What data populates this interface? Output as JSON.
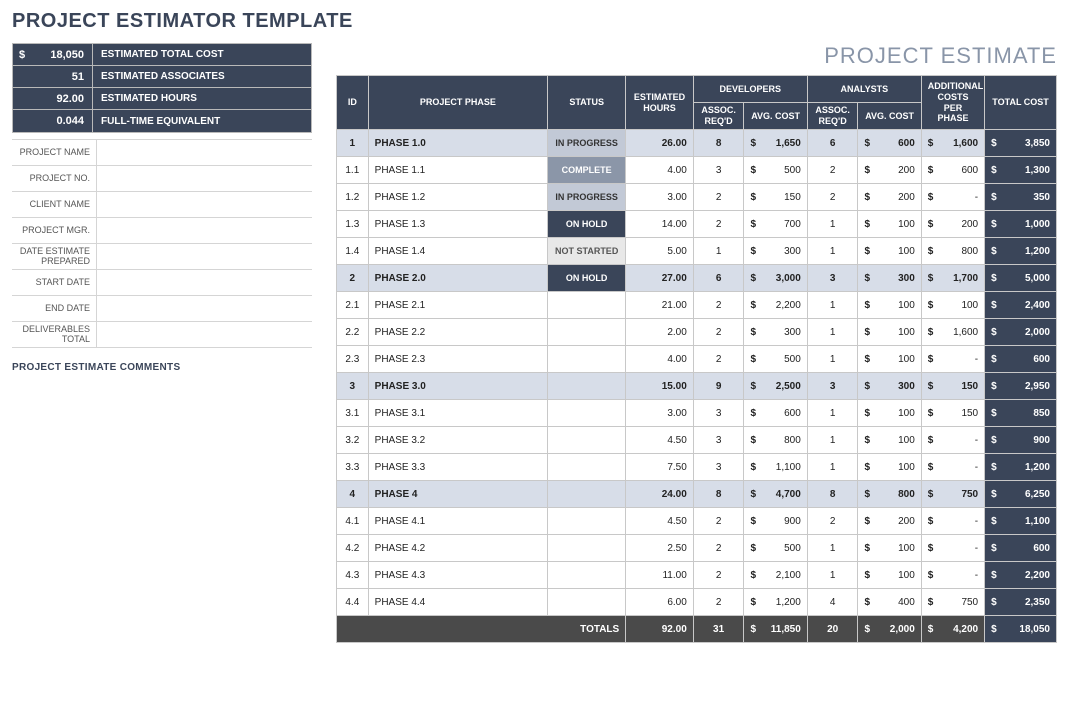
{
  "title": "PROJECT ESTIMATOR TEMPLATE",
  "est_title": "PROJECT ESTIMATE",
  "summary": [
    {
      "value": "18,050",
      "label": "ESTIMATED TOTAL COST",
      "money": true
    },
    {
      "value": "51",
      "label": "ESTIMATED ASSOCIATES"
    },
    {
      "value": "92.00",
      "label": "ESTIMATED HOURS"
    },
    {
      "value": "0.044",
      "label": "FULL-TIME EQUIVALENT"
    }
  ],
  "meta": [
    "PROJECT NAME",
    "PROJECT NO.",
    "CLIENT NAME",
    "PROJECT MGR.",
    "DATE ESTIMATE PREPARED",
    "START DATE",
    "END DATE",
    "DELIVERABLES TOTAL"
  ],
  "comments_label": "PROJECT ESTIMATE COMMENTS",
  "hdr": {
    "id": "ID",
    "phase": "PROJECT PHASE",
    "status": "STATUS",
    "hours": "ESTIMATED HOURS",
    "dev": "DEVELOPERS",
    "ana": "ANALYSTS",
    "assoc": "ASSOC. REQ'D",
    "avg": "AVG. COST",
    "add": "ADDITIONAL COSTS PER PHASE",
    "total": "TOTAL COST"
  },
  "rows": [
    {
      "id": "1",
      "phase": "PHASE 1.0",
      "status": "IN PROGRESS",
      "st": "progress",
      "hours": "26.00",
      "da": "8",
      "dc": "1,650",
      "aa": "6",
      "ac": "600",
      "add": "1,600",
      "total": "3,850",
      "parent": true
    },
    {
      "id": "1.1",
      "phase": "PHASE 1.1",
      "status": "COMPLETE",
      "st": "complete",
      "hours": "4.00",
      "da": "3",
      "dc": "500",
      "aa": "2",
      "ac": "200",
      "add": "600",
      "total": "1,300"
    },
    {
      "id": "1.2",
      "phase": "PHASE 1.2",
      "status": "IN PROGRESS",
      "st": "progress",
      "hours": "3.00",
      "da": "2",
      "dc": "150",
      "aa": "2",
      "ac": "200",
      "add": "-",
      "total": "350"
    },
    {
      "id": "1.3",
      "phase": "PHASE 1.3",
      "status": "ON HOLD",
      "st": "hold",
      "hours": "14.00",
      "da": "2",
      "dc": "700",
      "aa": "1",
      "ac": "100",
      "add": "200",
      "total": "1,000"
    },
    {
      "id": "1.4",
      "phase": "PHASE 1.4",
      "status": "NOT STARTED",
      "st": "notstarted",
      "hours": "5.00",
      "da": "1",
      "dc": "300",
      "aa": "1",
      "ac": "100",
      "add": "800",
      "total": "1,200"
    },
    {
      "id": "2",
      "phase": "PHASE 2.0",
      "status": "ON HOLD",
      "st": "hold",
      "hours": "27.00",
      "da": "6",
      "dc": "3,000",
      "aa": "3",
      "ac": "300",
      "add": "1,700",
      "total": "5,000",
      "parent": true
    },
    {
      "id": "2.1",
      "phase": "PHASE 2.1",
      "hours": "21.00",
      "da": "2",
      "dc": "2,200",
      "aa": "1",
      "ac": "100",
      "add": "100",
      "total": "2,400"
    },
    {
      "id": "2.2",
      "phase": "PHASE 2.2",
      "hours": "2.00",
      "da": "2",
      "dc": "300",
      "aa": "1",
      "ac": "100",
      "add": "1,600",
      "total": "2,000"
    },
    {
      "id": "2.3",
      "phase": "PHASE 2.3",
      "hours": "4.00",
      "da": "2",
      "dc": "500",
      "aa": "1",
      "ac": "100",
      "add": "-",
      "total": "600"
    },
    {
      "id": "3",
      "phase": "PHASE 3.0",
      "hours": "15.00",
      "da": "9",
      "dc": "2,500",
      "aa": "3",
      "ac": "300",
      "add": "150",
      "total": "2,950",
      "parent": true
    },
    {
      "id": "3.1",
      "phase": "PHASE 3.1",
      "hours": "3.00",
      "da": "3",
      "dc": "600",
      "aa": "1",
      "ac": "100",
      "add": "150",
      "total": "850"
    },
    {
      "id": "3.2",
      "phase": "PHASE 3.2",
      "hours": "4.50",
      "da": "3",
      "dc": "800",
      "aa": "1",
      "ac": "100",
      "add": "-",
      "total": "900"
    },
    {
      "id": "3.3",
      "phase": "PHASE 3.3",
      "hours": "7.50",
      "da": "3",
      "dc": "1,100",
      "aa": "1",
      "ac": "100",
      "add": "-",
      "total": "1,200"
    },
    {
      "id": "4",
      "phase": "PHASE 4",
      "hours": "24.00",
      "da": "8",
      "dc": "4,700",
      "aa": "8",
      "ac": "800",
      "add": "750",
      "total": "6,250",
      "parent": true
    },
    {
      "id": "4.1",
      "phase": "PHASE 4.1",
      "hours": "4.50",
      "da": "2",
      "dc": "900",
      "aa": "2",
      "ac": "200",
      "add": "-",
      "total": "1,100"
    },
    {
      "id": "4.2",
      "phase": "PHASE 4.2",
      "hours": "2.50",
      "da": "2",
      "dc": "500",
      "aa": "1",
      "ac": "100",
      "add": "-",
      "total": "600"
    },
    {
      "id": "4.3",
      "phase": "PHASE 4.3",
      "hours": "11.00",
      "da": "2",
      "dc": "2,100",
      "aa": "1",
      "ac": "100",
      "add": "-",
      "total": "2,200"
    },
    {
      "id": "4.4",
      "phase": "PHASE 4.4",
      "hours": "6.00",
      "da": "2",
      "dc": "1,200",
      "aa": "4",
      "ac": "400",
      "add": "750",
      "total": "2,350"
    }
  ],
  "totals": {
    "label": "TOTALS",
    "hours": "92.00",
    "da": "31",
    "dc": "11,850",
    "aa": "20",
    "ac": "2,000",
    "add": "4,200",
    "total": "18,050"
  }
}
